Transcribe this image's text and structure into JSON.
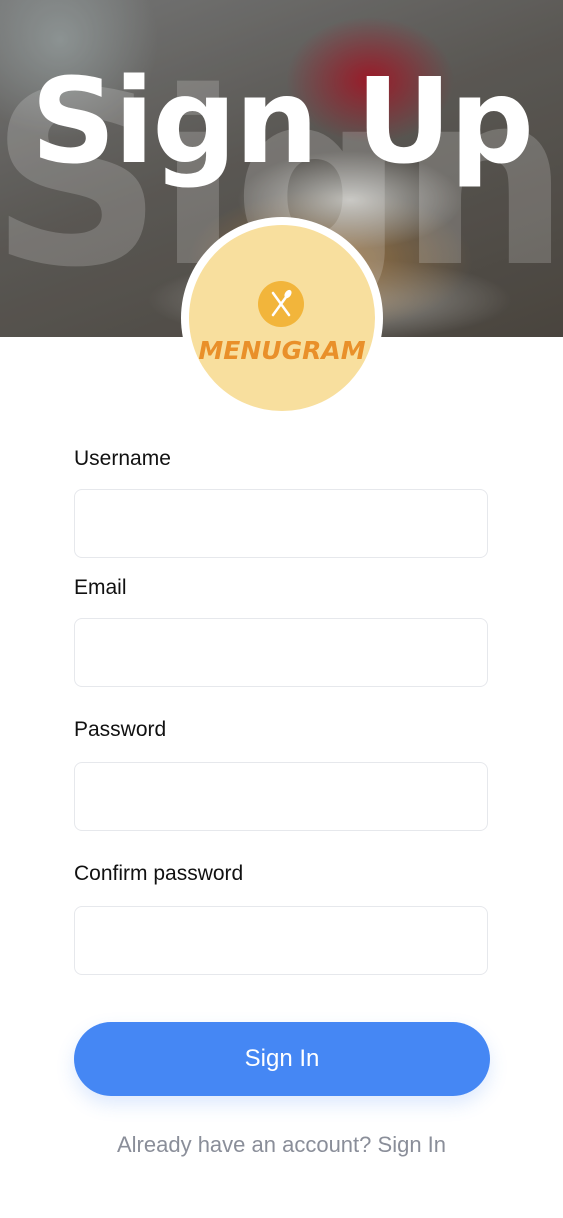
{
  "hero": {
    "title": "Sign Up",
    "ghost_text": "Sign"
  },
  "logo": {
    "brand": "MENUGRAM",
    "icon": "utensils-icon",
    "badge_color": "#f2b53b",
    "circle_color": "#f8df9e",
    "text_color": "#e9902a"
  },
  "form": {
    "username_label": "Username",
    "username_value": "",
    "email_label": "Email",
    "email_value": "",
    "password_label": "Password",
    "password_value": "",
    "confirm_label": "Confirm password",
    "confirm_value": ""
  },
  "button": {
    "label": "Sign In",
    "color": "#4587f4"
  },
  "footer": {
    "prompt": "Already  have an account?",
    "link": "Sign In"
  }
}
